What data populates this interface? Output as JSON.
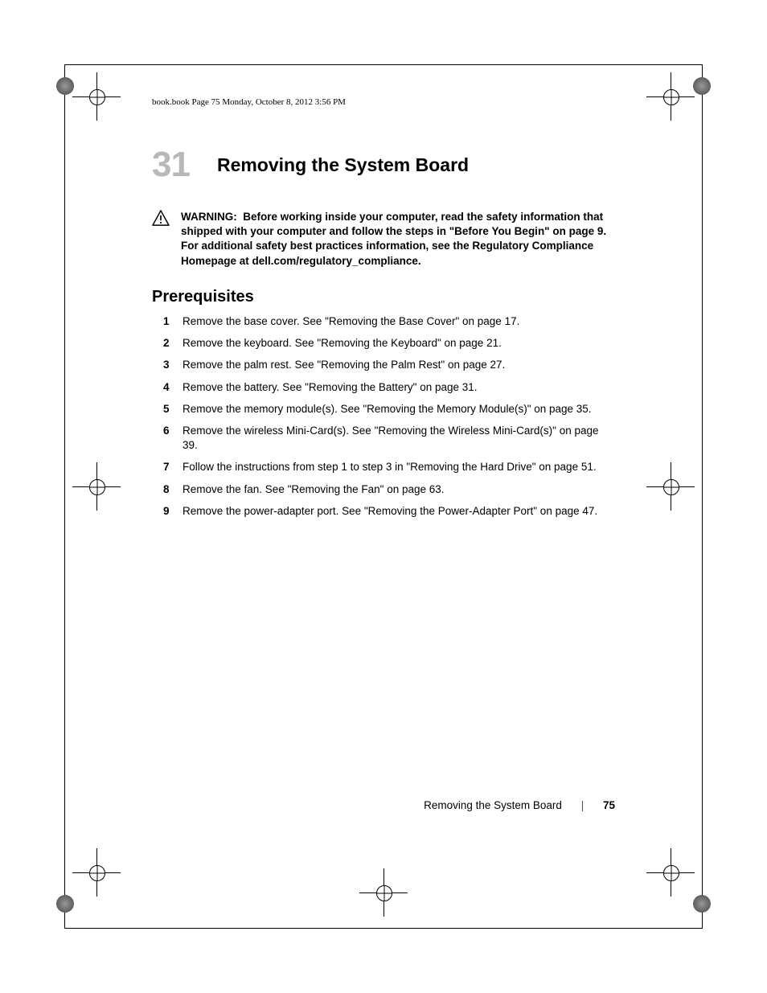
{
  "running_header": "book.book  Page 75  Monday, October 8, 2012  3:56 PM",
  "chapter": {
    "number": "31",
    "title": "Removing the System Board"
  },
  "warning": {
    "label": "WARNING:",
    "text": "Before working inside your computer, read the safety information that shipped with your computer and follow the steps in \"Before You Begin\" on page 9. For additional safety best practices information, see the Regulatory Compliance Homepage at dell.com/regulatory_compliance."
  },
  "section_heading": "Prerequisites",
  "steps": [
    "Remove the base cover. See \"Removing the Base Cover\" on page 17.",
    "Remove the keyboard. See \"Removing the Keyboard\" on page 21.",
    "Remove the palm rest. See \"Removing the Palm Rest\" on page 27.",
    "Remove the battery. See \"Removing the Battery\" on page 31.",
    "Remove the memory module(s). See \"Removing the Memory Module(s)\" on page 35.",
    "Remove the wireless Mini-Card(s). See \"Removing the Wireless Mini-Card(s)\" on page 39.",
    "Follow the instructions from step 1 to step 3 in \"Removing the Hard Drive\" on page 51.",
    "Remove the fan. See \"Removing the Fan\" on page 63.",
    "Remove the power-adapter port. See \"Removing the Power-Adapter Port\" on page 47."
  ],
  "footer": {
    "title": "Removing the System Board",
    "separator": "|",
    "page": "75"
  }
}
